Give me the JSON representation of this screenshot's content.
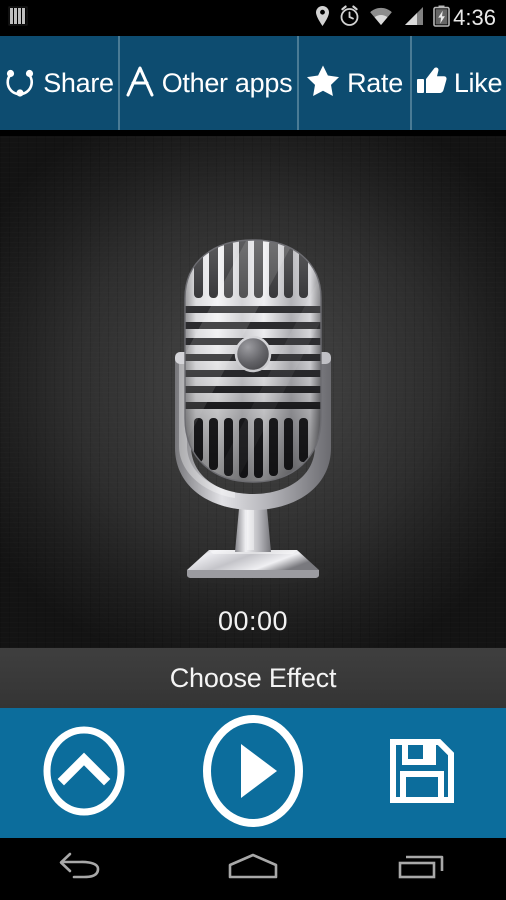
{
  "status_bar": {
    "clock": "4:36",
    "left_icons": [
      "equalizer-bars-icon"
    ],
    "right_icons": [
      "location-pin-icon",
      "alarm-clock-icon",
      "wifi-icon",
      "cell-signal-icon",
      "battery-charging-icon"
    ]
  },
  "action_bar": {
    "background_color": "#0d4c70",
    "divider_color": "#4a7b95",
    "items": [
      {
        "label": "Share",
        "icon": "share-icon"
      },
      {
        "label": "Other apps",
        "icon": "other-apps-icon"
      },
      {
        "label": "Rate",
        "icon": "star-icon"
      },
      {
        "label": "Like",
        "icon": "thumbs-up-icon"
      }
    ]
  },
  "stage": {
    "artwork": "retro-microphone-illustration",
    "background_color": "#3c3c3c",
    "timer": "00:00"
  },
  "effect_bar": {
    "label": "Choose Effect",
    "background_color": "#3a3a3a"
  },
  "transport_bar": {
    "background_color": "#0c6d9c",
    "buttons": [
      {
        "name": "record-button",
        "icon": "chevron-up-circle-icon"
      },
      {
        "name": "play-button",
        "icon": "play-circle-icon"
      },
      {
        "name": "save-button",
        "icon": "floppy-disk-icon"
      }
    ]
  },
  "nav_bar": {
    "background_color": "#000000",
    "buttons": [
      {
        "name": "back-button",
        "icon": "back-arrow-icon"
      },
      {
        "name": "home-button",
        "icon": "home-icon"
      },
      {
        "name": "recents-button",
        "icon": "recents-icon"
      }
    ]
  }
}
